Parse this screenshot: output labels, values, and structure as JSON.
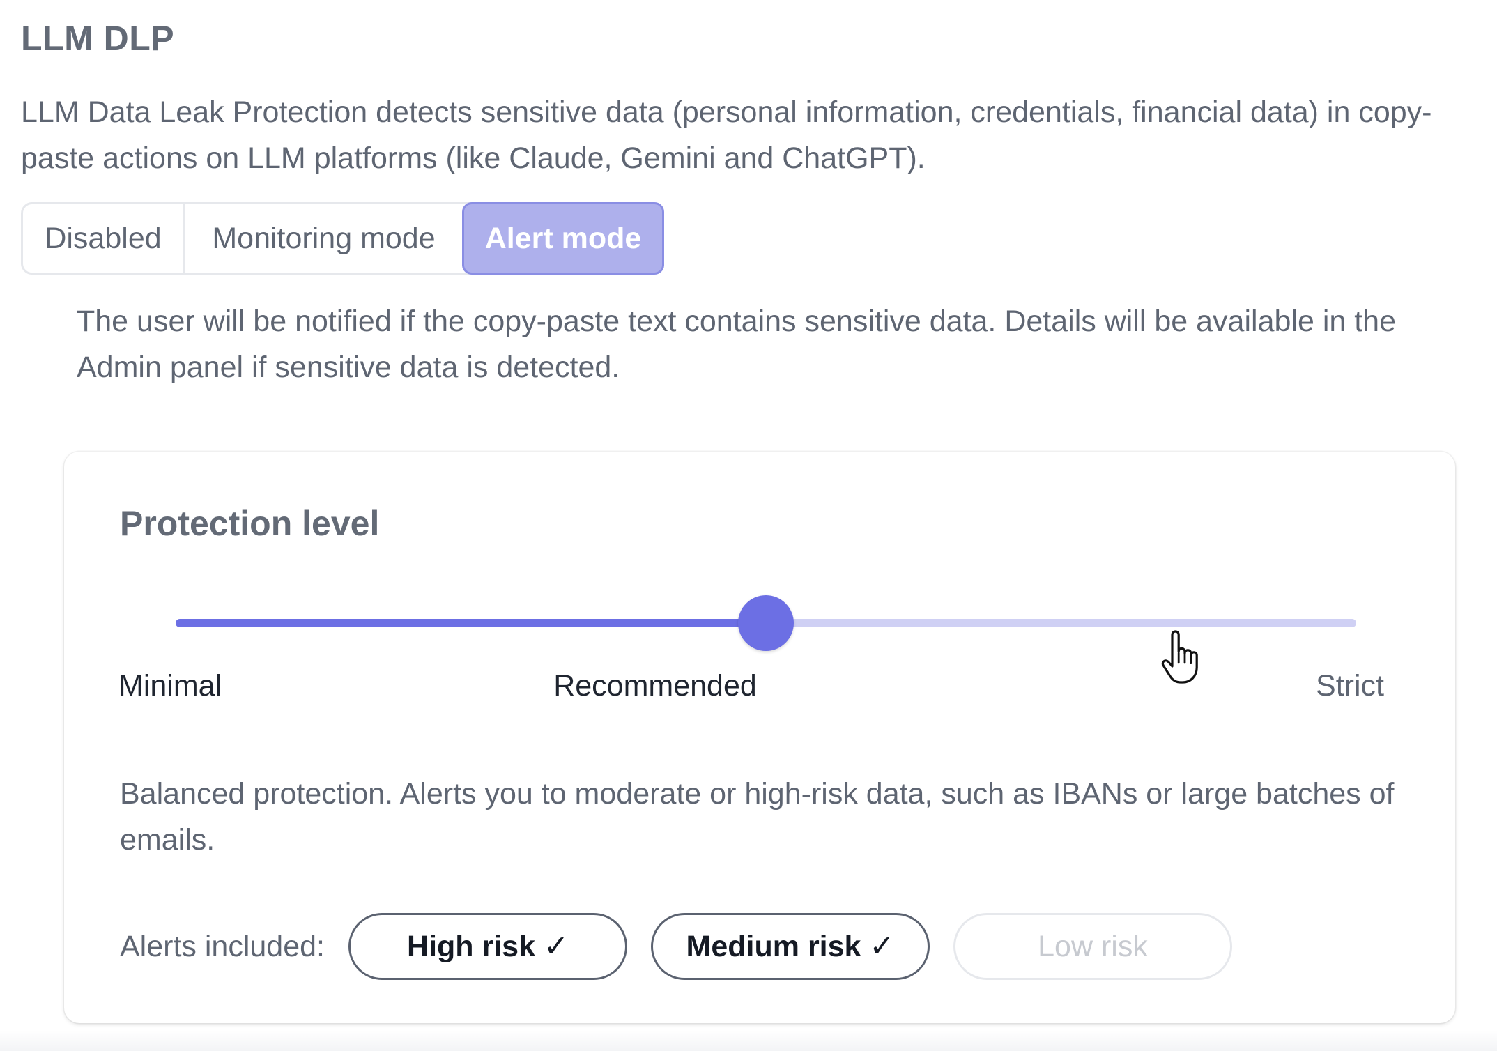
{
  "section": {
    "title": "LLM DLP",
    "description": "LLM Data Leak Protection detects sensitive data (personal information, credentials, financial data) in copy-paste actions on LLM platforms (like Claude, Gemini and ChatGPT)."
  },
  "modes": {
    "options": [
      {
        "label": "Disabled",
        "selected": false
      },
      {
        "label": "Monitoring mode",
        "selected": false
      },
      {
        "label": "Alert mode",
        "selected": true
      }
    ],
    "note": "The user will be notified if the copy-paste text contains sensitive data. Details will be available in the Admin panel if sensitive data is detected."
  },
  "protection": {
    "title": "Protection level",
    "slider": {
      "levels": [
        "Minimal",
        "Recommended",
        "Strict"
      ],
      "selected_index": 1,
      "value_fraction": 0.5
    },
    "description": "Balanced protection. Alerts you to moderate or high-risk data, such as IBANs or large batches of emails.",
    "alerts_label": "Alerts included:",
    "alerts": [
      {
        "label": "High risk ✓",
        "included": true
      },
      {
        "label": "Medium risk ✓",
        "included": true
      },
      {
        "label": "Low risk",
        "included": false
      }
    ]
  },
  "colors": {
    "accent": "#6c6fe4",
    "accent_light": "#cfd0f4",
    "selected_mode_bg": "#aeb0ec"
  },
  "icons": {
    "cursor": "hand-pointer-icon"
  }
}
